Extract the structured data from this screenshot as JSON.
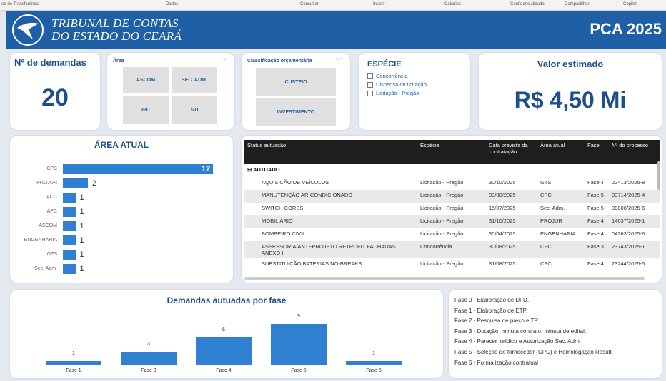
{
  "menu": [
    "ea de Transferência",
    "Dados",
    "Consultar",
    "Inserir",
    "Cálculos",
    "Confidencialidade",
    "Compartilhar",
    "Copilot"
  ],
  "header": {
    "org_line1": "TRIBUNAL DE CONTAS",
    "org_line2": "DO ESTADO DO CEARÁ",
    "pca": "PCA 2025"
  },
  "kpi_demandas": {
    "title": "Nº de demandas",
    "value": "20"
  },
  "slicer_area": {
    "title": "Área",
    "items": [
      "ASCOM",
      "SEC. ADM.",
      "IPC",
      "STI"
    ]
  },
  "slicer_classificacao": {
    "title": "Classificação orçamentária",
    "items": [
      "CUSTEIO",
      "INVESTIMENTO"
    ]
  },
  "especie": {
    "title": "ESPÉCIE",
    "items": [
      "Concorrência",
      "Dispensa de licitação",
      "Licitação - Pregão"
    ]
  },
  "valor": {
    "title": "Valor estimado",
    "value": "R$ 4,50 Mi"
  },
  "area_atual": {
    "title": "ÁREA ATUAL",
    "chart_data": {
      "type": "bar",
      "orientation": "horizontal",
      "categories": [
        "CPC",
        "PROJUR",
        "ACC",
        "APC",
        "ASCOM",
        "ENGENHARIA",
        "GTS",
        "Sec. Adm."
      ],
      "values": [
        12,
        2,
        1,
        1,
        1,
        1,
        1,
        1
      ]
    }
  },
  "table": {
    "headers": [
      "Status autuação",
      "Espécie",
      "Data prevista da contratação",
      "Área atual",
      "Fase",
      "Nº do processo"
    ],
    "group": "⊟ AUTUADO",
    "rows": [
      [
        "AQUISIÇÃO DE VEÍCULOS",
        "Licitação - Pregão",
        "30/10/2025",
        "GTS",
        "Fase 4",
        "22413/2025-8"
      ],
      [
        "MANUTENÇÃO AR-CONDICIONADO",
        "Licitação - Pregão",
        "03/08/2025",
        "CPC",
        "Fase 5",
        "03714/2025-4"
      ],
      [
        "SWITCH CORES",
        "Licitação - Pregão",
        "15/07/2025",
        "Sec. Adm.",
        "Fase 5",
        "09806/2025-6"
      ],
      [
        "MOBILIÁRIO",
        "Licitação - Pregão",
        "31/10/2025",
        "PROJUR",
        "Fase 4",
        "14637/2025-1"
      ],
      [
        "BOMBEIRO CIVIL",
        "Licitação - Pregão",
        "30/04/2025",
        "ENGENHARIA",
        "Fase 4",
        "04363/2025-6"
      ],
      [
        "ASSESSORIA/ANTEPROJETO RETROFIT FACHADAS ANEXO II",
        "Concorrência",
        "30/08/2025",
        "CPC",
        "Fase 3",
        "23743/2025-1"
      ],
      [
        "SUBSTITUIÇÃO BATERIAS NO-BREAKS",
        "Licitação - Pregão",
        "31/08/2025",
        "CPC",
        "Fase 4",
        "23244/2025-5"
      ]
    ]
  },
  "fases": {
    "title": "Demandas autuadas por fase",
    "chart_data": {
      "type": "bar",
      "categories": [
        "Fase 1",
        "Fase 3",
        "Fase 4",
        "Fase 5",
        "Fase 6"
      ],
      "values": [
        1,
        3,
        6,
        9,
        1
      ]
    }
  },
  "legend": [
    "Fase 0 - Elaboração de DFD.",
    "Fase 1 - Elaboração de ETP.",
    "Fase 2 - Pesquisa de preço e TR.",
    "Fase 3 - Dotação, minuta contrato, minuta de edital.",
    "Fase 4 - Parecer jurídico e Autorização Sec. Adm.",
    "Fase 5 - Seleção de fornecedor (CPC) e Homologação Result.",
    "Fase 6 - Formalização contratual"
  ]
}
